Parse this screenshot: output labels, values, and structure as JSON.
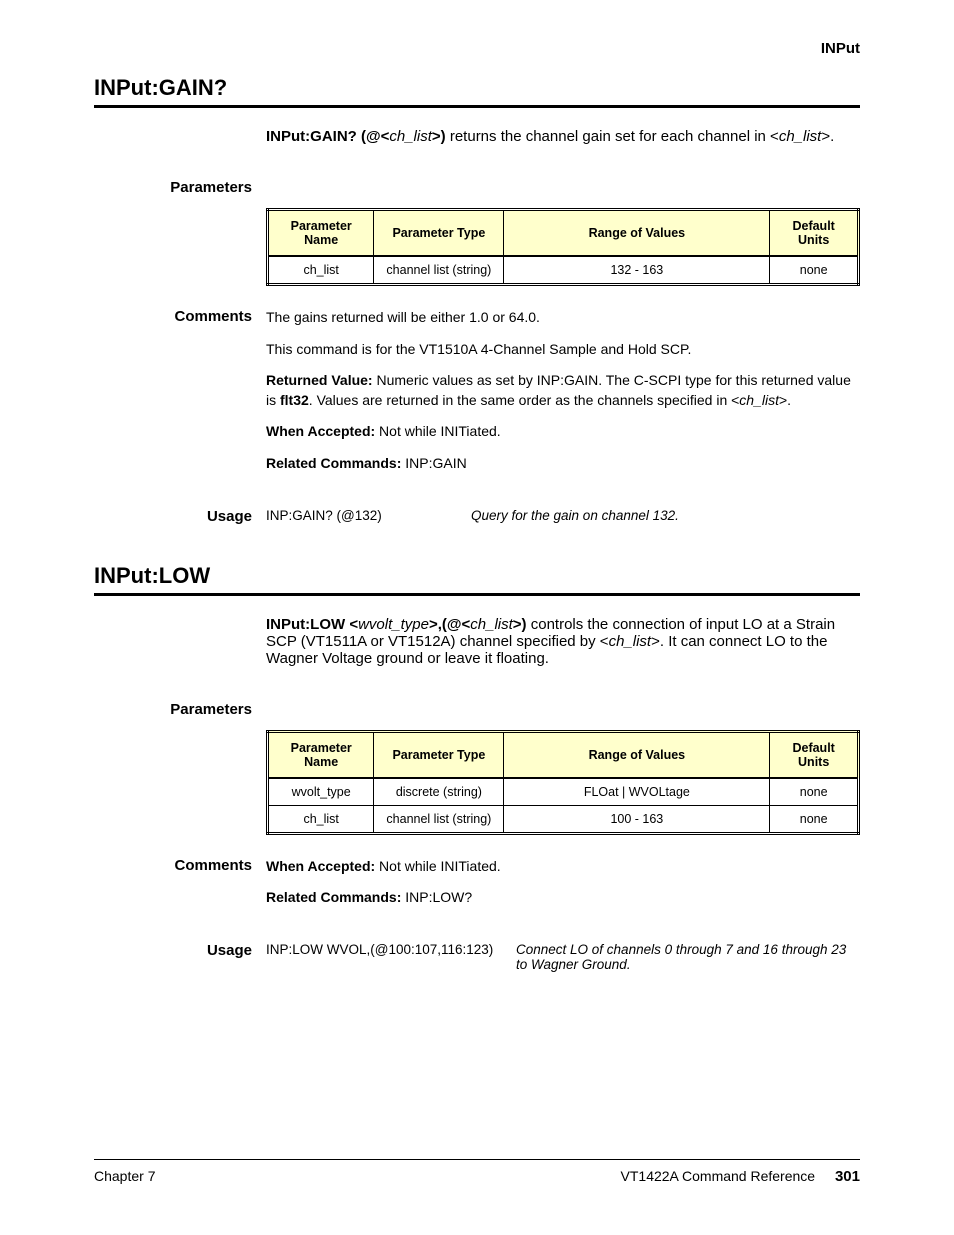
{
  "header": {
    "right_label": "INPut"
  },
  "gain": {
    "title": "INPut:GAIN?",
    "side_blank": "",
    "syntax_bold1": "INPut:GAIN?  (@<",
    "syntax_ital1": "ch_list",
    "syntax_bold2": ">)",
    "syntax_tail": "returns the channel gain set for each channel in <",
    "syntax_tail_ital": "ch_list",
    "syntax_tail_end": ">.",
    "parameters_label": "Parameters",
    "table": {
      "h1": "Parameter Name",
      "h2": "Parameter Type",
      "h3": "Range of Values",
      "h4": "Default Units",
      "r1c1": "ch_list",
      "r1c2": "channel list (string)",
      "r1c3": "132 - 163",
      "r1c4": "none"
    },
    "comments_label": "Comments",
    "comments": {
      "p1a": "The gains returned will be either 1.0 or 64.0.",
      "p2a": "This command is for the VT1510A 4-Channel Sample and Hold SCP.",
      "p3a": "Returned Value:",
      "p3b": " Numeric values as set by INP:GAIN. The C-SCPI type for this returned value is ",
      "p3c": "flt32",
      "p3d": ". Values are returned in the same order as the channels specified in <",
      "p3e": "ch_list",
      "p3f": ">.",
      "p4a": "When Accepted:",
      "p4b": " Not while INITiated.",
      "p5a": "Related Commands:",
      "p5b": " INP:GAIN"
    },
    "usage_label": "Usage",
    "usage": {
      "line1_left": "INP:GAIN? (@132)",
      "line1_right": "Query for the gain on channel 132."
    }
  },
  "low": {
    "title": "INPut:LOW",
    "syntax_bold1": "INPut:LOW <",
    "syntax_ital1": "wvolt_type",
    "syntax_bold2": ">,(@<",
    "syntax_ital2": "ch_list",
    "syntax_bold3": ">)",
    "syntax_tail1": "controls the connection of input LO at a Strain SCP (VT1511A or VT1512A) channel specified by <",
    "syntax_tail1_ital": "ch_list",
    "syntax_tail1_end": ">. It can connect  LO to the Wagner Voltage ground or leave it floating.",
    "parameters_label": "Parameters",
    "table": {
      "h1": "Parameter Name",
      "h2": "Parameter Type",
      "h3": "Range of Values",
      "h4": "Default Units",
      "r1c1": "wvolt_type",
      "r1c2": "discrete (string)",
      "r1c3": "FLOat | WVOLtage",
      "r1c4": "none",
      "r2c1": "ch_list",
      "r2c2": "channel list (string)",
      "r2c3": "100 - 163",
      "r2c4": "none"
    },
    "comments_label": "Comments",
    "comments": {
      "p1a": "When Accepted:",
      "p1b": " Not while INITiated.",
      "p2a": "Related Commands:",
      "p2b": " INP:LOW?"
    },
    "usage_label": "Usage",
    "usage": {
      "line1_left": "INP:LOW WVOL,(@100:107,116:123)",
      "line1_right": "Connect LO of channels 0 through 7 and 16 through 23 to Wagner Ground."
    }
  },
  "footer": {
    "left": "Chapter 7",
    "right_text": "VT1422A Command Reference",
    "page": "301"
  }
}
